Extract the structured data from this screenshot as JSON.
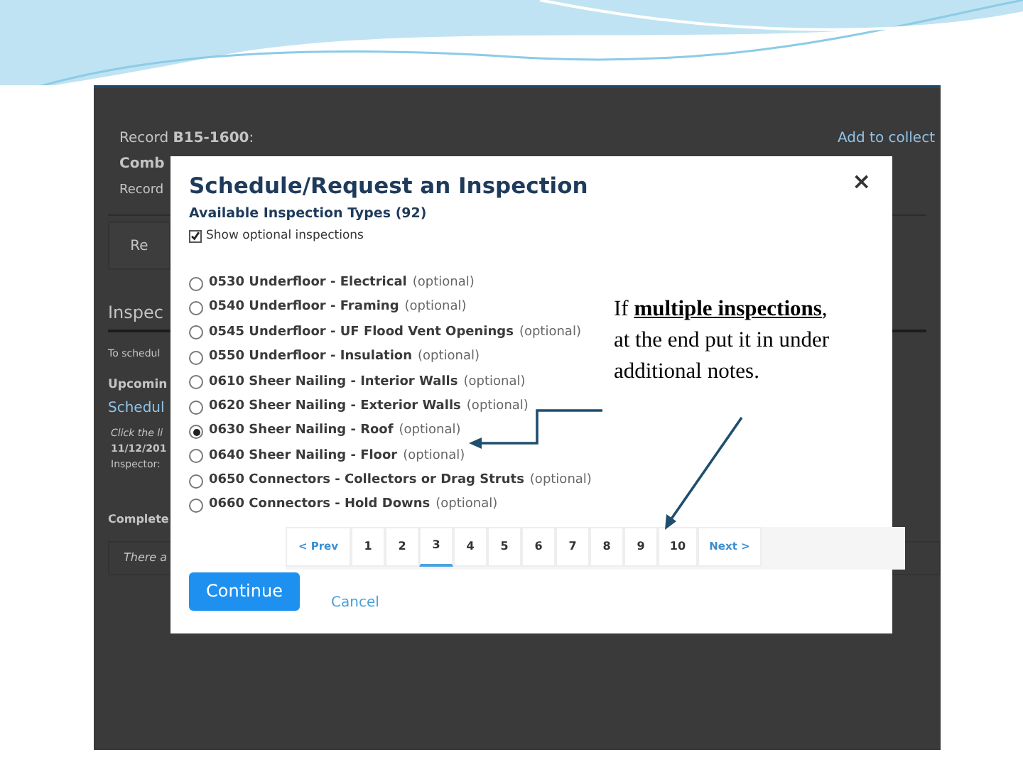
{
  "background_page": {
    "record_title": "Record **B15-1600**:",
    "line_2": "Comb",
    "line_3": "Record",
    "add_to_collection_link": "Add to collect",
    "tab": "Re",
    "section_title": "Inspec",
    "instruction": "To schedul",
    "upcoming_heading": "Upcomin",
    "schedule_link": "Schedul",
    "hint": "Click the li",
    "date": "11/12/201",
    "inspector_label": "Inspector:",
    "completed_heading": "Complete",
    "completed_message": "There a"
  },
  "dialog": {
    "title": "Schedule/Request an Inspection",
    "close": "×",
    "subtitle": "Available Inspection Types (92)",
    "show_optional": {
      "label": "Show optional inspections",
      "checked": true
    },
    "options": [
      {
        "label": "0530 Underfloor - Electrical",
        "note": "(optional)",
        "selected": false
      },
      {
        "label": "0540 Underfloor - Framing",
        "note": "(optional)",
        "selected": false
      },
      {
        "label": "0545 Underfloor - UF Flood Vent Openings",
        "note": "(optional)",
        "selected": false
      },
      {
        "label": "0550 Underfloor - Insulation",
        "note": "(optional)",
        "selected": false
      },
      {
        "label": "0610 Sheer Nailing - Interior Walls",
        "note": "(optional)",
        "selected": false
      },
      {
        "label": "0620 Sheer Nailing - Exterior Walls",
        "note": "(optional)",
        "selected": false
      },
      {
        "label": "0630 Sheer Nailing - Roof",
        "note": "(optional)",
        "selected": true
      },
      {
        "label": "0640 Sheer Nailing - Floor",
        "note": "(optional)",
        "selected": false
      },
      {
        "label": "0650 Connectors - Collectors or Drag Struts",
        "note": "(optional)",
        "selected": false
      },
      {
        "label": "0660 Connectors - Hold Downs",
        "note": "(optional)",
        "selected": false
      }
    ],
    "pagination": {
      "prev": "< Prev",
      "pages": [
        {
          "label": "1",
          "selected": false
        },
        {
          "label": "2",
          "selected": false
        },
        {
          "label": "3",
          "selected": true
        },
        {
          "label": "4",
          "selected": false
        },
        {
          "label": "5",
          "selected": false
        },
        {
          "label": "6",
          "selected": false
        },
        {
          "label": "7",
          "selected": false
        },
        {
          "label": "8",
          "selected": false
        },
        {
          "label": "9",
          "selected": false
        },
        {
          "label": "10",
          "selected": false
        }
      ],
      "next": "Next >"
    },
    "continue": "Continue",
    "cancel": "Cancel"
  },
  "annotation": {
    "text": "If **multiple inspections**, at the end put it in under additional notes."
  }
}
